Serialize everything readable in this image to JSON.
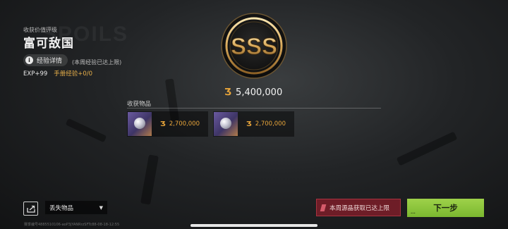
{
  "background_word": "SPOILS",
  "rank": {
    "label": "收获价值评级",
    "title": "富可敌国",
    "grade": "SSS"
  },
  "exp": {
    "details_label": "经验详情",
    "weekly_note": "(本周经验已达上限)",
    "exp_text": "EXP+99",
    "manual_exp": "手册经验+0/0"
  },
  "reward": {
    "currency_symbol": "Ʒ",
    "total": "5,400,000"
  },
  "loot": {
    "section_title": "收获物品",
    "items": [
      {
        "icon": "gem-icon",
        "value": "2,700,000"
      },
      {
        "icon": "gem-icon",
        "value": "2,700,000"
      }
    ]
  },
  "bottom": {
    "lost_items_label": "丢失物品",
    "crystal_limit": "本周源晶获取已达上限",
    "next_label": "下一步",
    "next_dots": "...",
    "footer_code": "赛季编号4885510106-aoP3jYANRrzSFTc88-08-18-12:55"
  },
  "colors": {
    "gold": "#e8a53a",
    "next_green": "#8cc63f",
    "limit_red": "#6e1d27"
  }
}
